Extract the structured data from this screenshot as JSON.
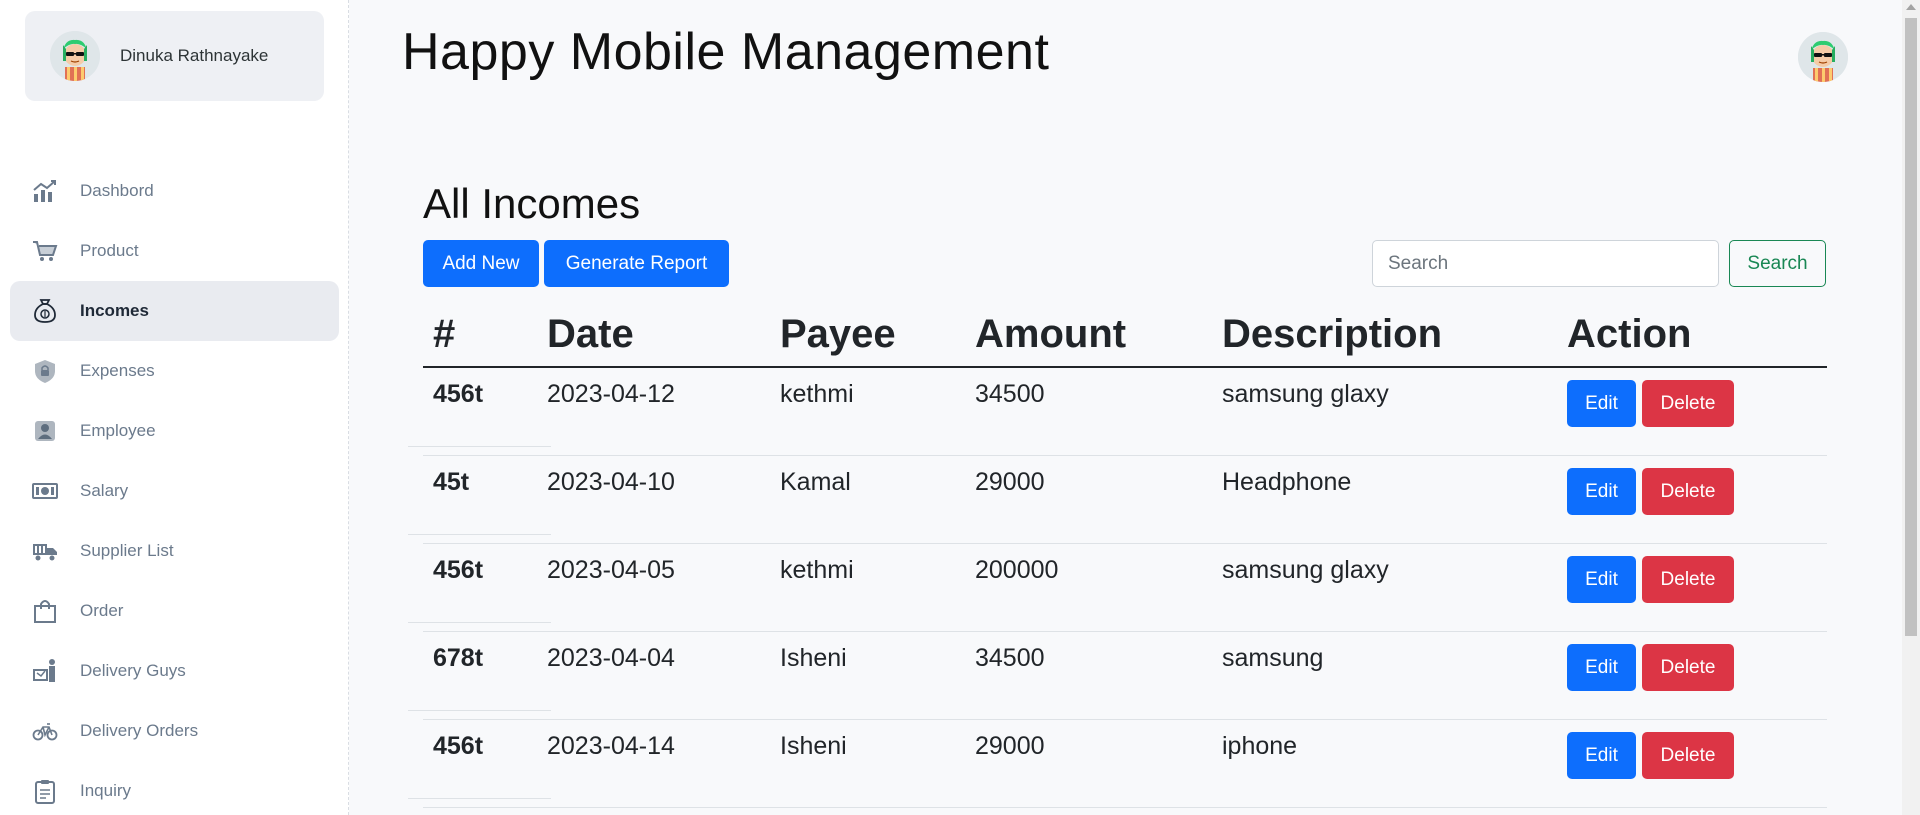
{
  "user": {
    "name": "Dinuka Rathnayake"
  },
  "header": {
    "title": "Happy Mobile Management"
  },
  "sidebar": {
    "items": [
      {
        "label": "Dashbord",
        "icon": "chart-icon",
        "active": false
      },
      {
        "label": "Product",
        "icon": "cart-icon",
        "active": false
      },
      {
        "label": "Incomes",
        "icon": "money-bag-icon",
        "active": true
      },
      {
        "label": "Expenses",
        "icon": "shield-lock-icon",
        "active": false
      },
      {
        "label": "Employee",
        "icon": "person-badge-icon",
        "active": false
      },
      {
        "label": "Salary",
        "icon": "cash-icon",
        "active": false
      },
      {
        "label": "Supplier List",
        "icon": "truck-icon",
        "active": false
      },
      {
        "label": "Order",
        "icon": "shopping-bag-icon",
        "active": false
      },
      {
        "label": "Delivery Guys",
        "icon": "delivery-person-icon",
        "active": false
      },
      {
        "label": "Delivery Orders",
        "icon": "bicycle-icon",
        "active": false
      },
      {
        "label": "Inquiry",
        "icon": "clipboard-icon",
        "active": false
      }
    ]
  },
  "page": {
    "heading": "All Incomes",
    "add_new_label": "Add New",
    "generate_report_label": "Generate Report",
    "search_placeholder": "Search",
    "search_button_label": "Search"
  },
  "table": {
    "columns": [
      "#",
      "Date",
      "Payee",
      "Amount",
      "Description",
      "Action"
    ],
    "rows": [
      {
        "id": "456t",
        "date": "2023-04-12",
        "payee": "kethmi",
        "amount": "34500",
        "description": "samsung glaxy"
      },
      {
        "id": "45t",
        "date": "2023-04-10",
        "payee": "Kamal",
        "amount": "29000",
        "description": "Headphone"
      },
      {
        "id": "456t",
        "date": "2023-04-05",
        "payee": "kethmi",
        "amount": "200000",
        "description": "samsung glaxy"
      },
      {
        "id": "678t",
        "date": "2023-04-04",
        "payee": "Isheni",
        "amount": "34500",
        "description": "samsung"
      },
      {
        "id": "456t",
        "date": "2023-04-14",
        "payee": "Isheni",
        "amount": "29000",
        "description": "iphone"
      }
    ],
    "edit_label": "Edit",
    "delete_label": "Delete"
  },
  "colors": {
    "primary": "#0d6efd",
    "danger": "#dc3545",
    "success": "#198754",
    "active_nav_bg": "#e9ebf0"
  }
}
